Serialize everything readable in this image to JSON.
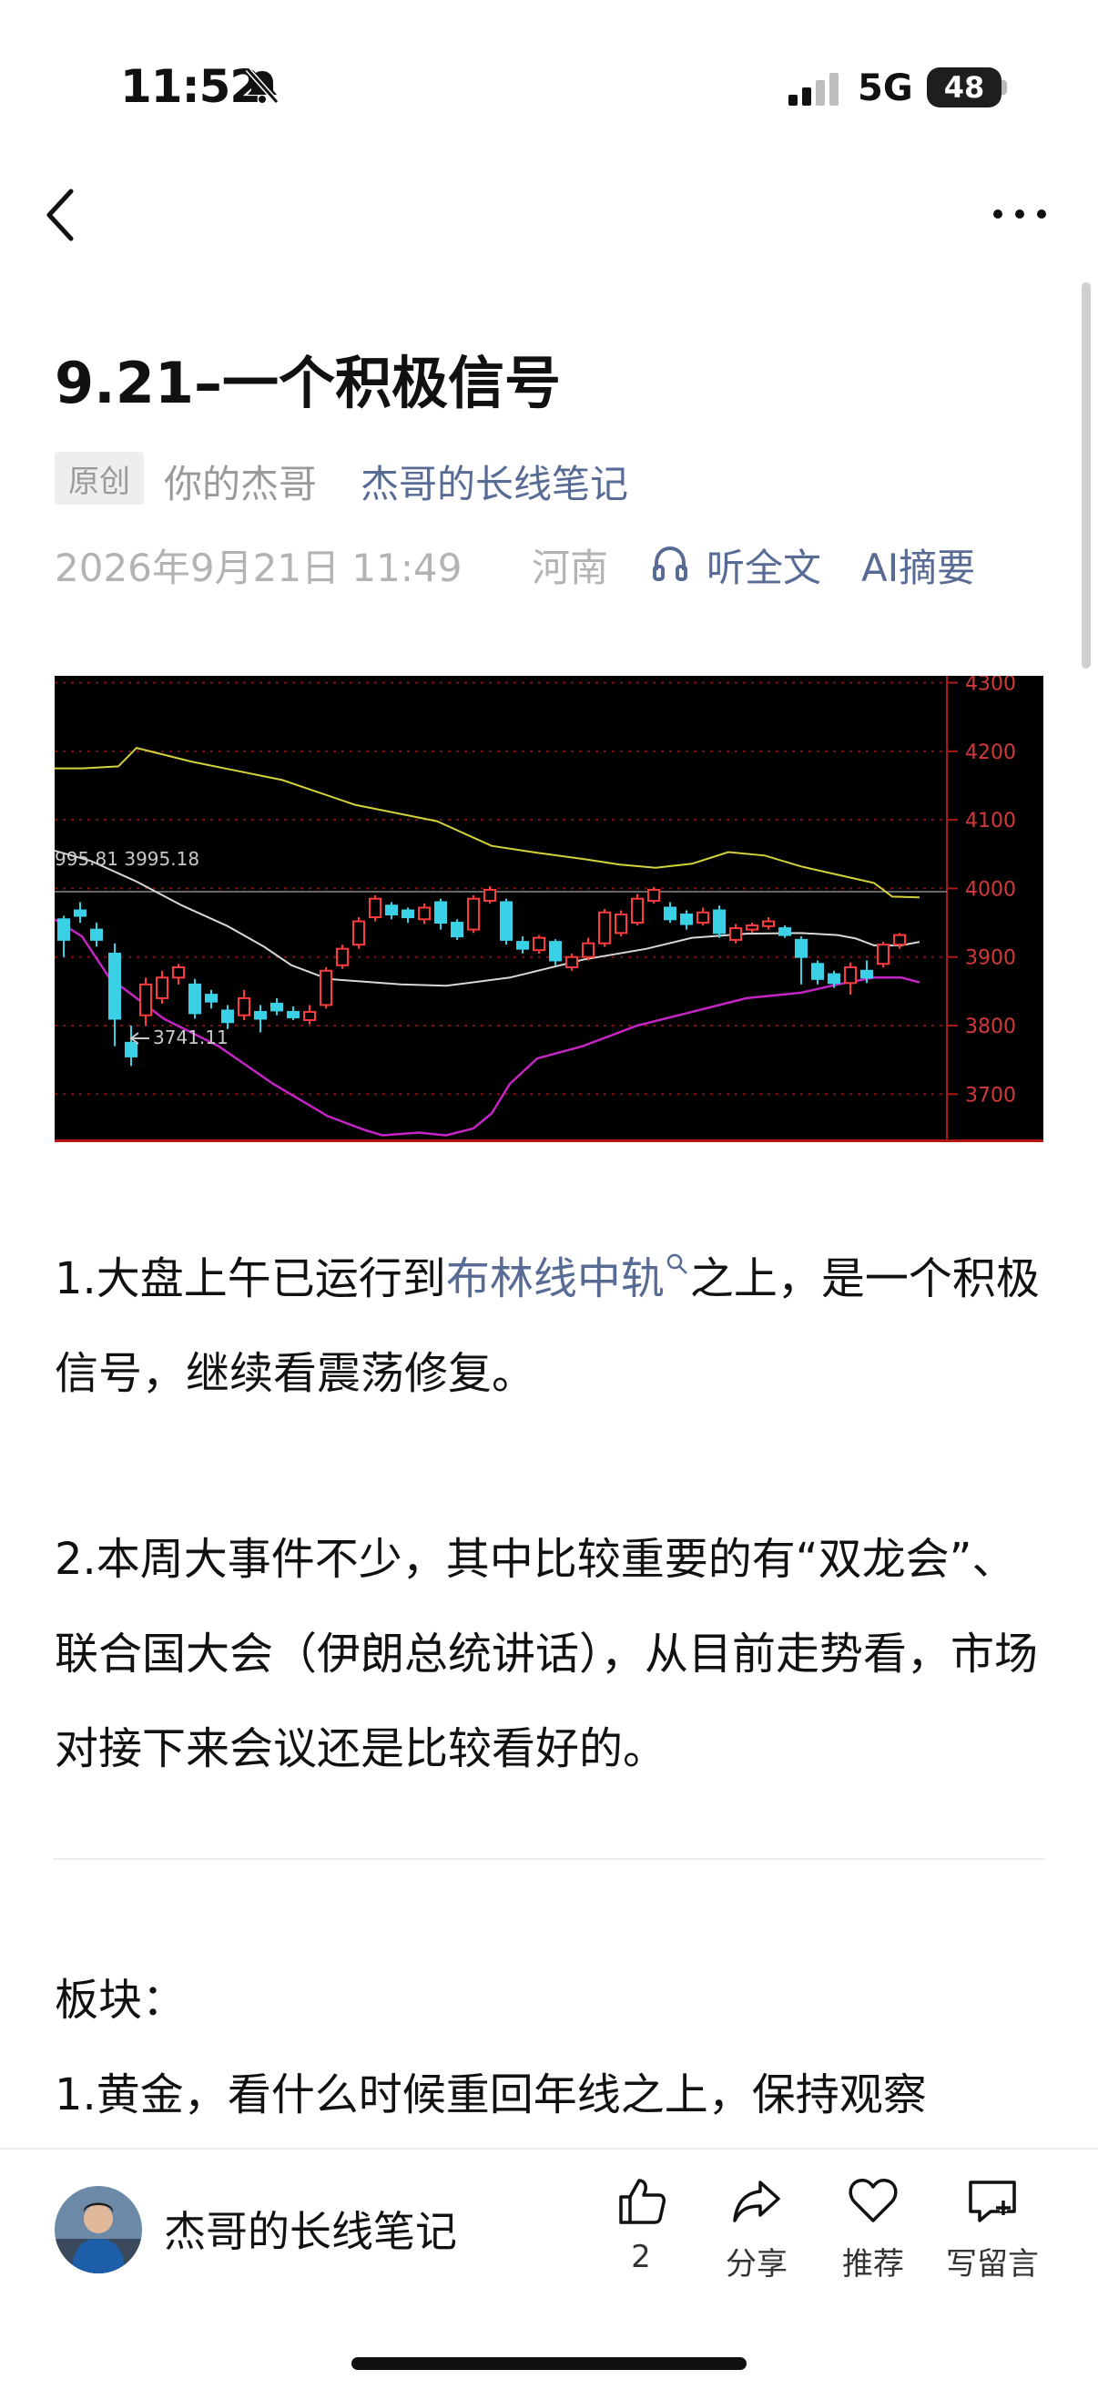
{
  "status": {
    "time": "11:52",
    "network": "5G",
    "battery": "48"
  },
  "article": {
    "title": "9.21–一个积极信号",
    "original_tag": "原创",
    "author": "你的杰哥",
    "account": "杰哥的长线笔记",
    "date": "2026年9月21日 11:49",
    "location": "河南",
    "listen_label": "听全文",
    "ai_label": "AI摘要"
  },
  "chart_data": {
    "type": "candlestick",
    "y_ticks": [
      "4300",
      "4200",
      "4100",
      "4000",
      "3900",
      "3800",
      "3700"
    ],
    "ylim": [
      3630,
      4310
    ],
    "annotations": {
      "top_line": "995.81 3995.18",
      "low": "3741.11"
    },
    "reference_level": 3995.18,
    "low_value": 3741.11
  },
  "body": {
    "p1_a": "1.大盘上午已运行到",
    "p1_link": "布林线中轨",
    "p1_b": "之上，是一个积极信号，继续看震荡修复。",
    "p2": "2.本周大事件不少，其中比较重要的有“双龙会”、联合国大会（伊朗总统讲话），从目前走势看，市场对接下来会议还是比较看好的。",
    "section": "板块：",
    "p3": "1.黄金，看什么时候重回年线之上，保持观察"
  },
  "bottom_bar": {
    "account_name": "杰哥的长线笔记",
    "like_count": "2",
    "share_label": "分享",
    "recommend_label": "推荐",
    "comment_label": "写留言"
  }
}
